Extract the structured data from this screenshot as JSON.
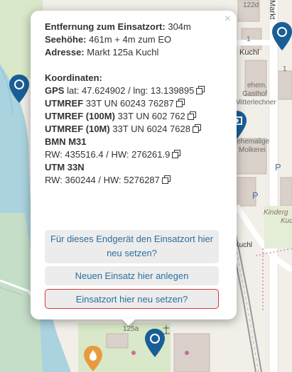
{
  "popup": {
    "close_symbol": "×",
    "distance_label": "Entfernung zum Einsatzort:",
    "distance_value": "304m",
    "elevation_label": "Seehöhe:",
    "elevation_value": "461m + 4m zum EO",
    "address_label": "Adresse:",
    "address_value": "Markt 125a Kuchl",
    "coords_heading": "Koordinaten:",
    "gps_label": "GPS",
    "gps_value": "lat: 47.624902 / lng: 13.139895",
    "utmref_label": "UTMREF",
    "utmref_value": "33T UN 60243 76287",
    "utmref100_label": "UTMREF (100M)",
    "utmref100_value": "33T UN 602 762",
    "utmref10_label": "UTMREF (10M)",
    "utmref10_value": "33T UN 6024 7628",
    "bmn_label": "BMN M31",
    "bmn_value": "RW: 435516.4 / HW: 276261.9",
    "utm_label": "UTM 33N",
    "utm_value": "RW: 360244 / HW: 5276287",
    "button_reset_device": "Für dieses Endgerät den Einsatzort hier neu setzen?",
    "button_new_incident": "Neuen Einsatz hier anlegen",
    "button_reset_location": "Einsatzort hier neu setzen?",
    "copy_icon": "copy-icon",
    "close_icon": "close-icon"
  },
  "map_labels": {
    "house_122d": "122d",
    "house_1": "1",
    "house_1b": "1",
    "kuchl": "Kuchl",
    "gasthof_1": "ehem.",
    "gasthof_2": "Gasthof",
    "gasthof_3": "Mitterlechner",
    "molkerei_1": "ehemalige",
    "molkerei_2": "Molkerei",
    "parking": "P",
    "kinder_1": "Kinderg",
    "kinder_2": "Kuch",
    "kuchl_rail": "Kuchl",
    "house_125a": "125a",
    "street_vertical": "Markt"
  },
  "colors": {
    "water": "#aad3df",
    "green": "#d8e8c8",
    "marker_blue": "#1a5e96",
    "marker_orange": "#e89b3e",
    "button_text": "#2b6fa0",
    "danger_border": "#d43a3a"
  }
}
